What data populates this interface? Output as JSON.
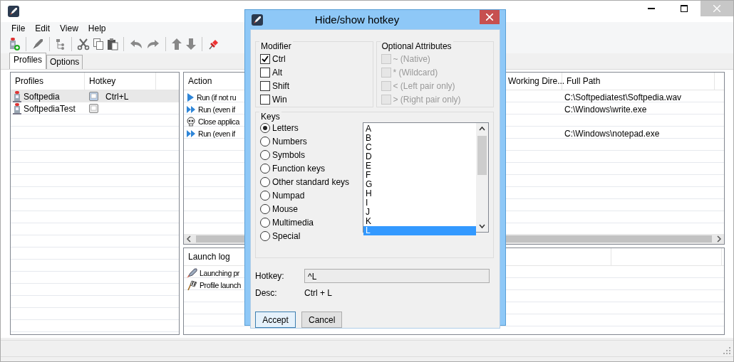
{
  "menu": [
    "File",
    "Edit",
    "View",
    "Help"
  ],
  "tabs": [
    {
      "label": "Profiles",
      "selected": true
    },
    {
      "label": "Options",
      "selected": false
    }
  ],
  "profiles_table": {
    "columns": [
      "Profiles",
      "Hotkey"
    ],
    "rows": [
      {
        "name": "Softpedia",
        "hotkey": "Ctrl+L",
        "selected": true
      },
      {
        "name": "SoftpediaTest",
        "selected": false
      }
    ]
  },
  "actions_table": {
    "columns": [
      "Action",
      "Working Dire...",
      "Full Path"
    ],
    "rows": [
      {
        "kind": "run",
        "action": "Run (if not ru",
        "full_path": "C:\\Softpediatest\\Softpedia.wav"
      },
      {
        "kind": "run_always",
        "action": "Run (even if",
        "full_path": "C:\\Windows\\write.exe"
      },
      {
        "kind": "close",
        "action": "Close applica"
      },
      {
        "kind": "run_always",
        "action": "Run (even if",
        "full_path": "C:\\Windows\\notepad.exe"
      }
    ]
  },
  "launch_log": {
    "columns": [
      "Launch log"
    ],
    "rows": [
      {
        "kind": "launch",
        "text": "Launching pr"
      },
      {
        "kind": "finish",
        "text": "Profile launch"
      }
    ]
  },
  "dialog": {
    "title": "Hide/show hotkey",
    "modifier": {
      "title": "Modifier",
      "items": [
        {
          "label": "Ctrl",
          "checked": true
        },
        {
          "label": "Alt",
          "checked": false
        },
        {
          "label": "Shift",
          "checked": false
        },
        {
          "label": "Win",
          "checked": false
        }
      ]
    },
    "optional": {
      "title": "Optional Attributes",
      "items": [
        {
          "label": "~ (Native)",
          "checked": false,
          "disabled": true
        },
        {
          "label": "* (Wildcard)",
          "checked": false,
          "disabled": true
        },
        {
          "label": "< (Left pair only)",
          "checked": false,
          "disabled": true
        },
        {
          "label": "> (Right pair only)",
          "checked": false,
          "disabled": true
        }
      ]
    },
    "keys": {
      "title": "Keys",
      "options": [
        {
          "label": "Letters",
          "selected": true
        },
        {
          "label": "Numbers",
          "selected": false
        },
        {
          "label": "Symbols",
          "selected": false
        },
        {
          "label": "Function keys",
          "selected": false
        },
        {
          "label": "Other standard keys",
          "selected": false
        },
        {
          "label": "Numpad",
          "selected": false
        },
        {
          "label": "Mouse",
          "selected": false
        },
        {
          "label": "Multimedia",
          "selected": false
        },
        {
          "label": "Special",
          "selected": false
        }
      ],
      "list": [
        {
          "label": "A",
          "selected": false
        },
        {
          "label": "B",
          "selected": false
        },
        {
          "label": "C",
          "selected": false
        },
        {
          "label": "D",
          "selected": false
        },
        {
          "label": "E",
          "selected": false
        },
        {
          "label": "F",
          "selected": false
        },
        {
          "label": "G",
          "selected": false
        },
        {
          "label": "H",
          "selected": false
        },
        {
          "label": "I",
          "selected": false
        },
        {
          "label": "J",
          "selected": false
        },
        {
          "label": "K",
          "selected": false
        },
        {
          "label": "L",
          "selected": true
        }
      ]
    },
    "hotkey": {
      "label": "Hotkey:",
      "value": "^L"
    },
    "desc": {
      "label": "Desc:",
      "value": "Ctrl + L"
    },
    "buttons": [
      {
        "label": "Accept",
        "default": true
      },
      {
        "label": "Cancel",
        "default": false
      }
    ]
  }
}
